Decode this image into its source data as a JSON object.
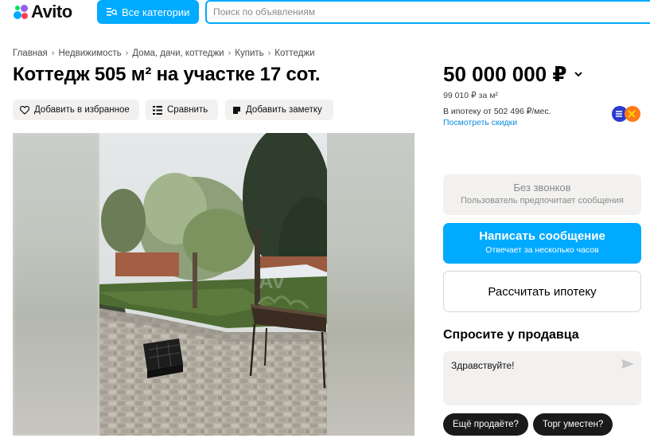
{
  "header": {
    "logo_text": "Avito",
    "categories_label": "Все категории",
    "search_placeholder": "Поиск по объявлениям",
    "search_value": ""
  },
  "breadcrumbs": [
    "Главная",
    "Недвижимость",
    "Дома, дачи, коттеджи",
    "Купить",
    "Коттеджи"
  ],
  "listing": {
    "title": "Коттедж 505 м² на участке 17 сот.",
    "actions": {
      "favorite": "Добавить в избранное",
      "compare": "Сравнить",
      "note": "Добавить заметку"
    }
  },
  "pricing": {
    "price": "50 000 000 ₽",
    "price_per_meter": "99 010 ₽ за м²",
    "mortgage": "В ипотеку от 502 496 ₽/мес.",
    "discounts_link": "Посмотреть скидки"
  },
  "contact": {
    "no_calls_title": "Без звонков",
    "no_calls_sub": "Пользователь предпочитает сообщения",
    "message_title": "Написать сообщение",
    "message_sub": "Отвечает за несколько часов",
    "mortgage_calc": "Рассчитать ипотеку",
    "ask_title": "Спросите у продавца",
    "ask_value": "Здравствуйте!",
    "chips": [
      "Ещё продаёте?",
      "Торг уместен?"
    ]
  },
  "colors": {
    "accent": "#00aaff",
    "chip_bg": "#1a1a1a",
    "button_gray": "#f2f1f0",
    "link": "#0a8ce0"
  },
  "icons": [
    "heart-icon",
    "compare-icon",
    "note-icon",
    "chevron-down-icon",
    "send-icon",
    "bank-logo-icon",
    "catalog-icon"
  ]
}
